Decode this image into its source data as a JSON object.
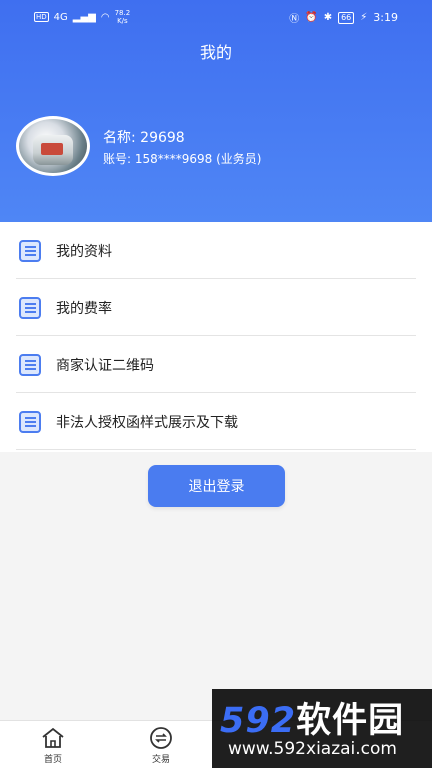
{
  "status_bar": {
    "hd": "HD",
    "network": "4G",
    "speed_value": "78.2",
    "speed_unit": "K/s",
    "battery": "66",
    "time": "3:19"
  },
  "header": {
    "title": "我的",
    "name_line": "名称: 29698",
    "account_line": "账号: 158****9698 (业务员)"
  },
  "menu": {
    "items": [
      {
        "label": "我的资料",
        "icon": "list-icon"
      },
      {
        "label": "我的费率",
        "icon": "list-icon"
      },
      {
        "label": "商家认证二维码",
        "icon": "list-icon"
      },
      {
        "label": "非法人授权函样式展示及下载",
        "icon": "list-icon"
      }
    ]
  },
  "logout_label": "退出登录",
  "tabbar": {
    "items": [
      {
        "label": "首页",
        "icon": "home-icon"
      },
      {
        "label": "交易",
        "icon": "trade-icon"
      }
    ]
  },
  "watermark": {
    "digits": "592",
    "text": "软件园",
    "url": "www.592xiazai.com"
  },
  "colors": {
    "primary": "#4a7cf0",
    "header_top": "#3f6ff0",
    "header_bottom": "#4f86f5"
  }
}
